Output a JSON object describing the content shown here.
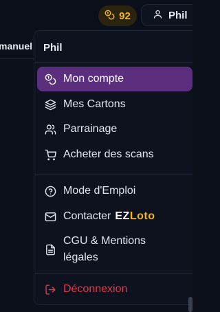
{
  "topbar": {
    "coins_value": "92",
    "user_name": "Phil",
    "behind_label": "manuel"
  },
  "menu": {
    "header": "Phil",
    "items": [
      {
        "label": "Mon compte",
        "icon": "coins-icon"
      },
      {
        "label": "Mes Cartons",
        "icon": "layers-icon"
      },
      {
        "label": "Parrainage",
        "icon": "users-icon"
      },
      {
        "label": "Acheter des scans",
        "icon": "cart-icon"
      },
      {
        "label": "Mode d'Emploi",
        "icon": "help-circle-icon"
      },
      {
        "label": "Contacter",
        "icon": "mail-icon"
      },
      {
        "label": "CGU & Mentions légales",
        "icon": "document-icon"
      },
      {
        "label": "Déconnexion",
        "icon": "logout-icon"
      }
    ],
    "contact_brand_a": "EZ",
    "contact_brand_b": "Loto"
  },
  "colors": {
    "background": "#0b0f1a",
    "accent_active": "#5b2f7e",
    "coin": "#f5b81a",
    "danger": "#e23a4a"
  }
}
